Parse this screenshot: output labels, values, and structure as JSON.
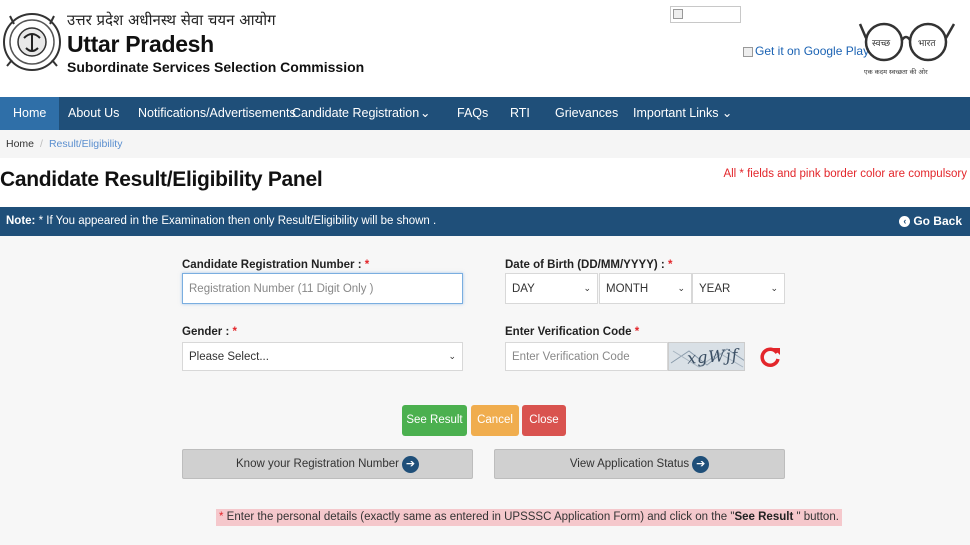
{
  "header": {
    "hindi_title": "उत्तर प्रदेश अधीनस्थ सेवा चयन आयोग",
    "title": "Uttar Pradesh",
    "subtitle": "Subordinate Services Selection Commission",
    "google_play": "Get it on Google Play",
    "swachh_left": "स्वच्छ",
    "swachh_right": "भारत",
    "swachh_tagline": "एक कदम स्वच्छता की ओर"
  },
  "nav": {
    "items": [
      {
        "label": "Home",
        "active": true
      },
      {
        "label": "About Us"
      },
      {
        "label": "Notifications/Advertisements"
      },
      {
        "label": "Candidate Registration"
      },
      {
        "label": "⌄"
      },
      {
        "label": "FAQs"
      },
      {
        "label": "RTI"
      },
      {
        "label": "Grievances"
      },
      {
        "label": "Important Links ⌄"
      }
    ]
  },
  "breadcrumb": {
    "home": "Home",
    "separator": "/",
    "current": "Result/Eligibility"
  },
  "page": {
    "title": "Candidate Result/Eligibility Panel",
    "compulsory_note": "All * fields and pink border color are compulsory"
  },
  "note_bar": {
    "label": "Note:",
    "text": " * If You appeared in the Examination then only Result/Eligibility will be shown .",
    "go_back": "Go Back"
  },
  "form": {
    "reg_label": "Candidate Registration Number :",
    "reg_placeholder": "Registration Number (11 Digit Only )",
    "dob_label": "Date of Birth (DD/MM/YYYY) :",
    "day": "DAY",
    "month": "MONTH",
    "year": "YEAR",
    "gender_label": "Gender :",
    "gender_value": "Please Select...",
    "captcha_label": "Enter Verification Code",
    "captcha_placeholder": "Enter Verification Code",
    "captcha_text": "xgWjf",
    "required_mark": "*"
  },
  "buttons": {
    "see_result": "See Result",
    "cancel": "Cancel",
    "close": "Close",
    "know_registration": "Know your Registration Number",
    "view_status": "View Application Status"
  },
  "footer_note": {
    "prefix": "* Enter the personal details (exactly same as entered in UPSSSC Application Form) and click on the \"",
    "bold": "See Result",
    "suffix": " \" button."
  },
  "colors": {
    "navbar": "#1f4f79",
    "nav_active": "#2f6fa8",
    "required": "#e3262b",
    "see_result": "#4bb04f",
    "cancel": "#f0ad4e",
    "close": "#d9534f"
  }
}
